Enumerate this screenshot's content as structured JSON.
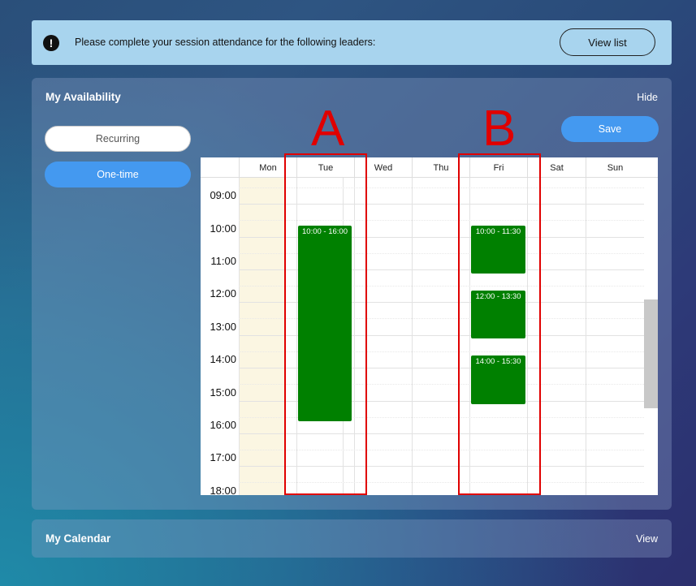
{
  "banner": {
    "message": "Please complete your session attendance for the following leaders:",
    "button_label": "View list",
    "icon": "exclamation-icon"
  },
  "availability": {
    "title": "My Availability",
    "hide_label": "Hide",
    "recurring_label": "Recurring",
    "onetime_label": "One-time",
    "save_label": "Save",
    "days": [
      "Mon",
      "Tue",
      "Wed",
      "Thu",
      "Fri",
      "Sat",
      "Sun"
    ],
    "times": [
      "09:00",
      "10:00",
      "11:00",
      "12:00",
      "13:00",
      "14:00",
      "15:00",
      "16:00",
      "17:00",
      "18:00"
    ],
    "events": [
      {
        "day": "Tue",
        "start": "10:00",
        "end": "16:00",
        "label": "10:00 - 16:00"
      },
      {
        "day": "Fri",
        "start": "10:00",
        "end": "11:30",
        "label": "10:00 - 11:30"
      },
      {
        "day": "Fri",
        "start": "12:00",
        "end": "13:30",
        "label": "12:00 - 13:30"
      },
      {
        "day": "Fri",
        "start": "14:00",
        "end": "15:30",
        "label": "14:00 - 15:30"
      }
    ],
    "annotations": {
      "a": "A",
      "b": "B"
    }
  },
  "calendar": {
    "title": "My Calendar",
    "view_label": "View"
  },
  "colors": {
    "accent": "#4499f0",
    "event": "#008000",
    "annotation": "#e00000",
    "banner": "#a8d4ee"
  }
}
